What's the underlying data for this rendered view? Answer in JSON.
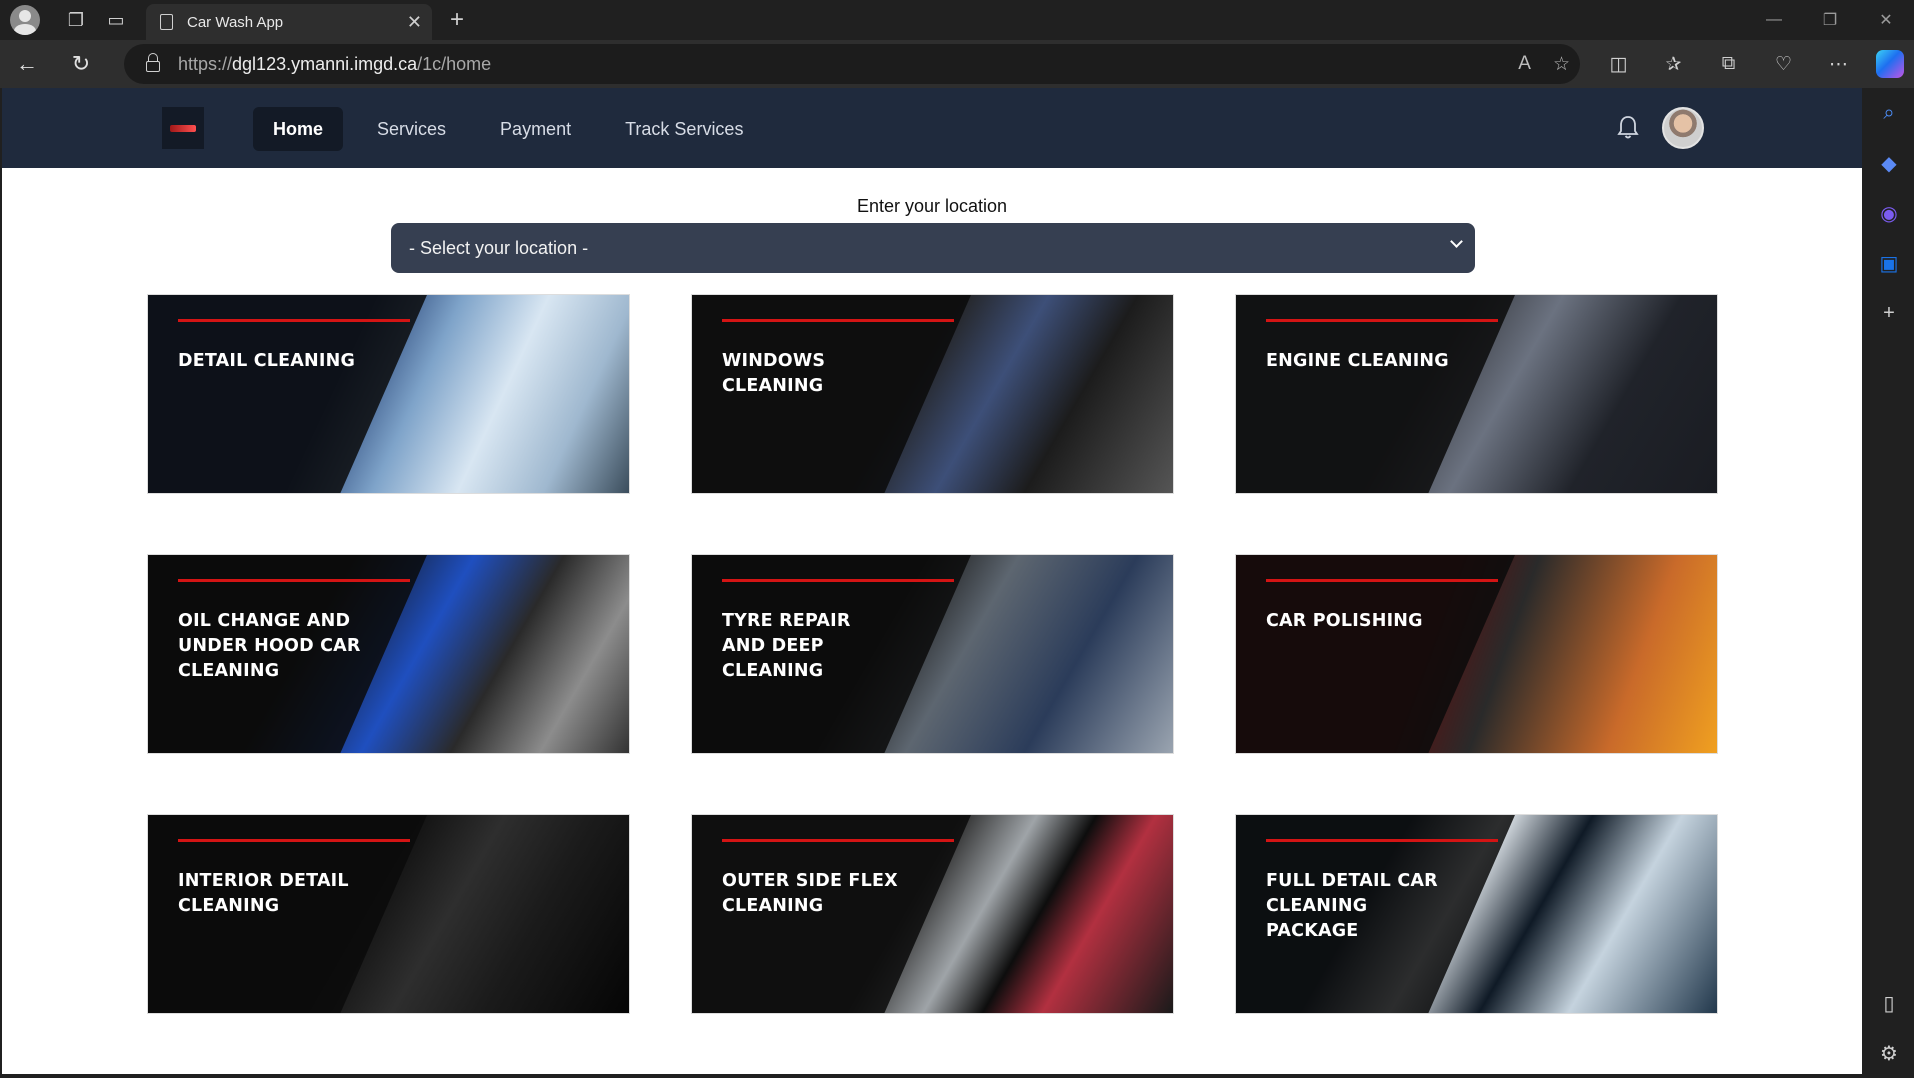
{
  "browser": {
    "tab_title": "Car Wash App",
    "url_scheme": "https://",
    "url_host": "dgl123.ymanni.imgd.ca",
    "url_path": "/1c/home"
  },
  "site": {
    "nav": [
      {
        "label": "Home",
        "active": true
      },
      {
        "label": "Services",
        "active": false
      },
      {
        "label": "Payment",
        "active": false
      },
      {
        "label": "Track Services",
        "active": false
      }
    ],
    "location_label": "Enter your location",
    "location_selected": "- Select your location -"
  },
  "services": [
    {
      "title": "Detail Cleaning"
    },
    {
      "title": "Windows Cleaning"
    },
    {
      "title": "Engine Cleaning"
    },
    {
      "title": "Oil Change and Under Hood Car Cleaning"
    },
    {
      "title": "Tyre Repair and Deep Cleaning"
    },
    {
      "title": "Car Polishing"
    },
    {
      "title": "Interior Detail Cleaning"
    },
    {
      "title": "Outer Side Flex Cleaning"
    },
    {
      "title": "Full Detail Car Cleaning Package"
    }
  ],
  "colors": {
    "nav_bg": "#1f2a3d",
    "nav_active_bg": "#131a26",
    "select_bg": "#363f51",
    "accent_line": "#d41414"
  }
}
